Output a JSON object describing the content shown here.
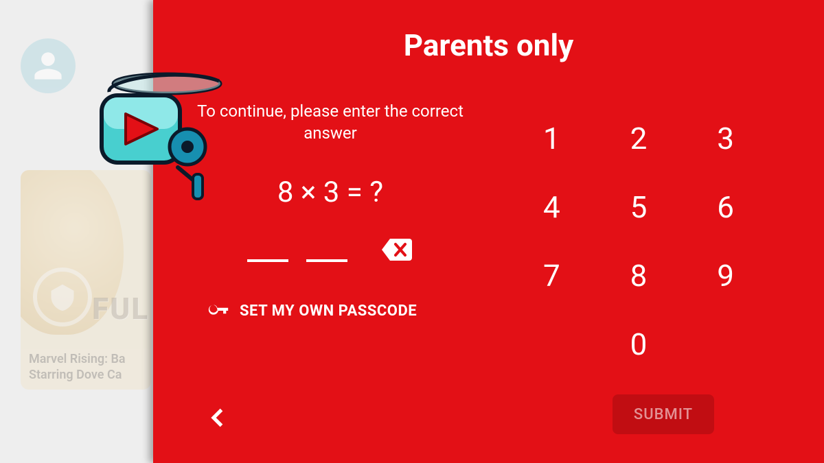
{
  "background": {
    "card_word": "FUL",
    "caption_line1": "Marvel Rising: Ba",
    "caption_line2": "Starring Dove Ca"
  },
  "modal": {
    "title": "Parents only",
    "instruction": "To continue, please enter the correct answer",
    "question": "8 × 3 = ?",
    "set_passcode_label": "SET MY OWN PASSCODE",
    "submit_label": "SUBMIT",
    "answer_digits_expected": 2,
    "keypad": {
      "k1": "1",
      "k2": "2",
      "k3": "3",
      "k4": "4",
      "k5": "5",
      "k6": "6",
      "k7": "7",
      "k8": "8",
      "k9": "9",
      "k0": "0"
    },
    "colors": {
      "panel": "#e31016",
      "text": "#ffffff"
    }
  }
}
